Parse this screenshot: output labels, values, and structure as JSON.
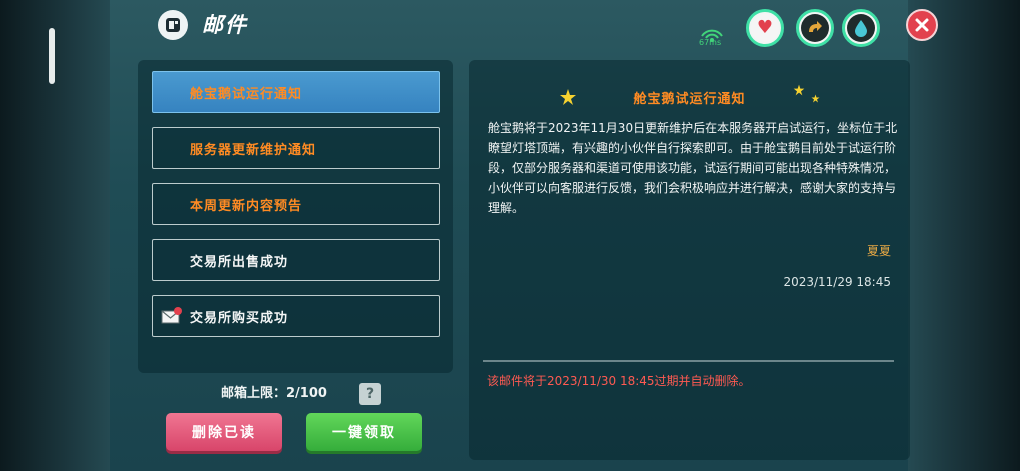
{
  "header": {
    "title": "邮件",
    "ping": "67ms"
  },
  "colors": {
    "unread_orange": "#ff8b23",
    "selected_blue": "#3683c0",
    "expire_red": "#ff5a52",
    "delete_pink": "#d8456a",
    "collect_green": "#35ad3b"
  },
  "mail_list": [
    {
      "label": "舱宝鹅试运行通知",
      "selected": true,
      "read": false,
      "has_attachment_icon": false
    },
    {
      "label": "服务器更新维护通知",
      "selected": false,
      "read": false,
      "has_attachment_icon": false
    },
    {
      "label": "本周更新内容预告",
      "selected": false,
      "read": false,
      "has_attachment_icon": false
    },
    {
      "label": "交易所出售成功",
      "selected": false,
      "read": true,
      "has_attachment_icon": false
    },
    {
      "label": "交易所购买成功",
      "selected": false,
      "read": true,
      "has_attachment_icon": true
    }
  ],
  "mailbox": {
    "limit_label": "邮箱上限：",
    "limit_value": "2/100",
    "help": "?"
  },
  "buttons": {
    "delete_read": "删除已读",
    "collect_all": "一键领取"
  },
  "detail": {
    "title": "舱宝鹅试运行通知",
    "body": "舱宝鹅将于2023年11月30日更新维护后在本服务器开启试运行，坐标位于北瞭望灯塔顶端，有兴趣的小伙伴自行探索即可。由于舱宝鹅目前处于试运行阶段，仅部分服务器和渠道可使用该功能，试运行期间可能出现各种特殊情况，小伙伴可以向客服进行反馈，我们会积极响应并进行解决，感谢大家的支持与理解。",
    "signer": "夏夏",
    "date": "2023/11/29 18:45",
    "expire_notice": "该邮件将于2023/11/30 18:45过期并自动删除。"
  },
  "status_icons": [
    "heart-icon",
    "stamina-icon",
    "water-drop-icon"
  ]
}
